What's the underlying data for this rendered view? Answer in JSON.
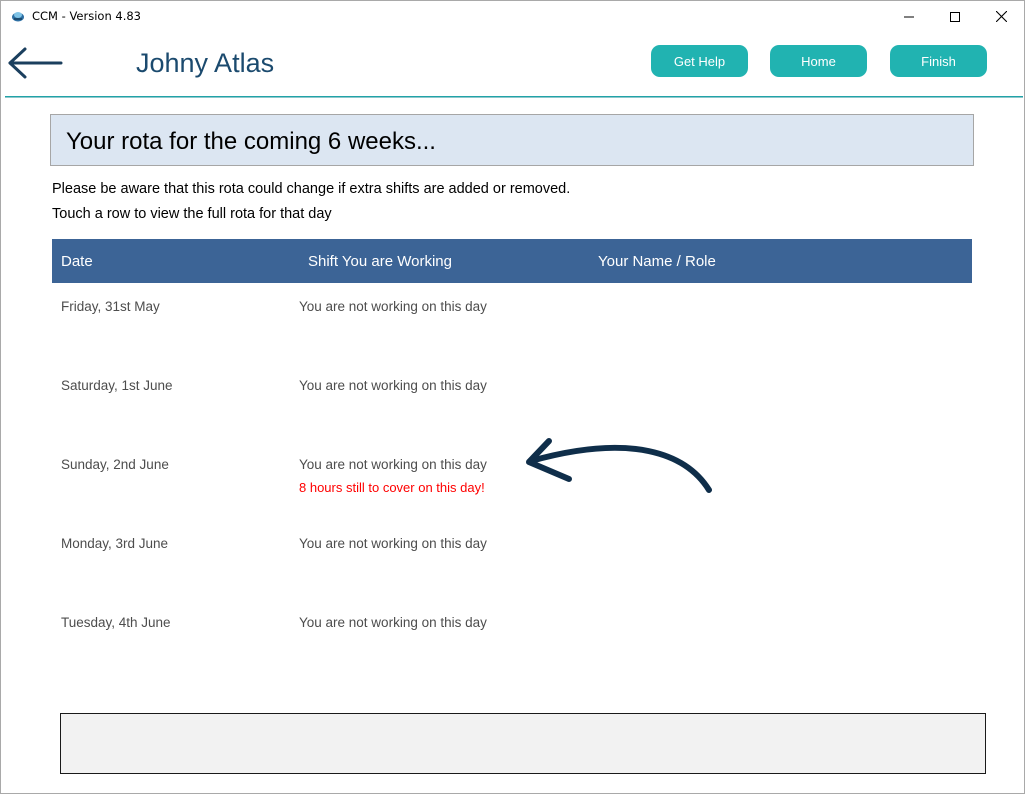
{
  "window": {
    "title": "CCM - Version 4.83",
    "controls": {
      "minimize": "minimize-icon",
      "maximize": "maximize-icon",
      "close": "close-icon"
    }
  },
  "header": {
    "user_name": "Johny Atlas",
    "buttons": {
      "help": "Get Help",
      "home": "Home",
      "finish": "Finish"
    },
    "accent_color": "#21b3b1",
    "name_color": "#1b4a6e"
  },
  "banner": {
    "title": "Your rota for the coming 6 weeks..."
  },
  "notices": {
    "change_warning": "Please be aware that this rota could change if extra shifts are added or removed.",
    "touch_hint": "Touch a row to view the full rota for that day"
  },
  "table": {
    "header_color": "#3c6496",
    "columns": [
      "Date",
      "Shift You are Working",
      "Your Name / Role"
    ],
    "rows": [
      {
        "date": "Friday, 31st May",
        "shift": "You are not working on this day",
        "role": "",
        "warning": ""
      },
      {
        "date": "Saturday, 1st June",
        "shift": "You are not working on this day",
        "role": "",
        "warning": ""
      },
      {
        "date": "Sunday, 2nd June",
        "shift": "You are not working on this day",
        "role": "",
        "warning": "8 hours still to cover on this day!"
      },
      {
        "date": "Monday, 3rd June",
        "shift": "You are not working on this day",
        "role": "",
        "warning": ""
      },
      {
        "date": "Tuesday, 4th June",
        "shift": "You are not working on this day",
        "role": "",
        "warning": ""
      }
    ]
  },
  "warning_color": "#ff0000"
}
